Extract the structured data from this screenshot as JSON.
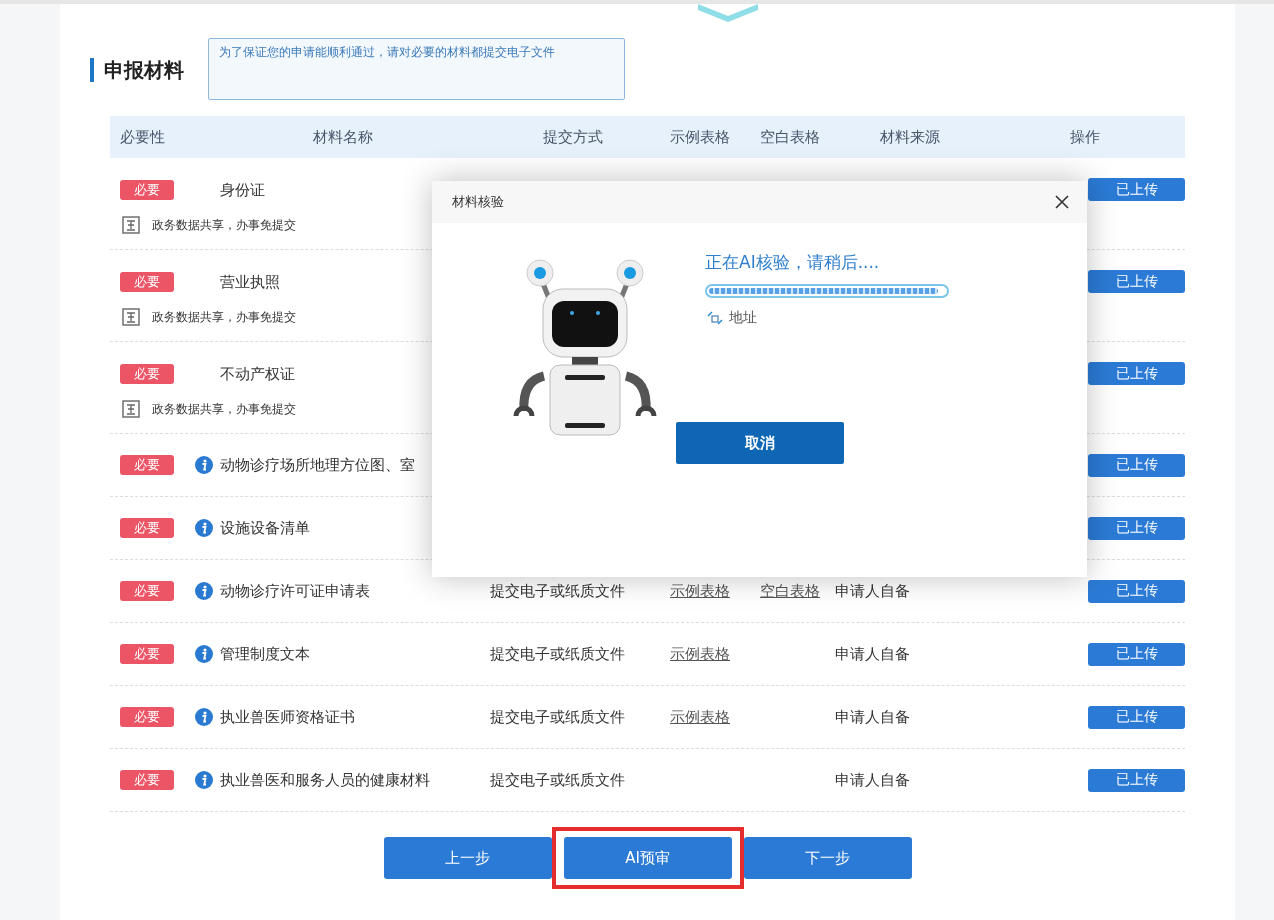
{
  "section": {
    "title": "申报材料",
    "notice": "为了保证您的申请能顺利通过，请对必要的材料都提交电子文件"
  },
  "table": {
    "columns": [
      "必要性",
      "材料名称",
      "提交方式",
      "示例表格",
      "空白表格",
      "材料来源",
      "操作"
    ],
    "rows": [
      {
        "kind": "shared",
        "tag": "必要",
        "name": "身份证",
        "note": "政务数据共享，办事免提交",
        "action": "已上传"
      },
      {
        "kind": "shared",
        "tag": "必要",
        "name": "营业执照",
        "note": "政务数据共享，办事免提交",
        "action": "已上传"
      },
      {
        "kind": "shared",
        "tag": "必要",
        "name": "不动产权证",
        "note": "政务数据共享，办事免提交",
        "action": "已上传"
      },
      {
        "kind": "info",
        "tag": "必要",
        "name": "动物诊疗场所地理方位图、室",
        "action": "已上传"
      },
      {
        "kind": "info",
        "tag": "必要",
        "name": "设施设备清单",
        "action": "已上传"
      },
      {
        "kind": "info",
        "tag": "必要",
        "name": "动物诊疗许可证申请表",
        "submit": "提交电子或纸质文件",
        "example": "示例表格",
        "blank": "空白表格",
        "source": "申请人自备",
        "action": "已上传"
      },
      {
        "kind": "info",
        "tag": "必要",
        "name": "管理制度文本",
        "submit": "提交电子或纸质文件",
        "example": "示例表格",
        "source": "申请人自备",
        "action": "已上传"
      },
      {
        "kind": "info",
        "tag": "必要",
        "name": "执业兽医师资格证书",
        "submit": "提交电子或纸质文件",
        "example": "示例表格",
        "source": "申请人自备",
        "action": "已上传"
      },
      {
        "kind": "info",
        "tag": "必要",
        "name": "执业兽医和服务人员的健康材料",
        "submit": "提交电子或纸质文件",
        "source": "申请人自备",
        "action": "已上传"
      }
    ]
  },
  "buttons": [
    {
      "label": "上一步",
      "highlighted": false
    },
    {
      "label": "AI预审",
      "highlighted": true
    },
    {
      "label": "下一步",
      "highlighted": false
    }
  ],
  "dialog": {
    "title": "材料核验",
    "status": "正在AI核验，请稍后....",
    "progress": {
      "level": 0.97
    },
    "step": "地址",
    "cancel": "取消"
  }
}
